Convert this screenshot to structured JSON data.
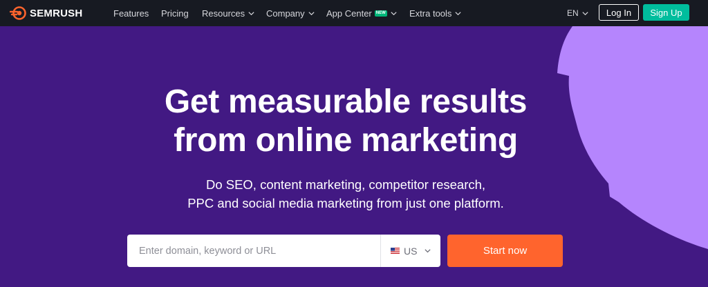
{
  "brand": {
    "name": "SEMRUSH",
    "accent": "#ff642d"
  },
  "nav": {
    "items": [
      {
        "label": "Features",
        "dropdown": false
      },
      {
        "label": "Pricing",
        "dropdown": false
      },
      {
        "label": "Resources",
        "dropdown": true
      },
      {
        "label": "Company",
        "dropdown": true
      },
      {
        "label": "App Center",
        "dropdown": true,
        "badge": "NEW"
      },
      {
        "label": "Extra tools",
        "dropdown": true
      }
    ],
    "language": "EN",
    "login_label": "Log In",
    "signup_label": "Sign Up"
  },
  "hero": {
    "headline_line1": "Get measurable results",
    "headline_line2": "from online marketing",
    "sub_line1": "Do SEO, content marketing, competitor research,",
    "sub_line2": "PPC and social media marketing from just one platform.",
    "background": "#421983",
    "shape_color": "#b585fd"
  },
  "search": {
    "placeholder": "Enter domain, keyword or URL",
    "value": "",
    "country": "US",
    "flag_icon": "us-flag-icon",
    "submit_label": "Start now"
  }
}
